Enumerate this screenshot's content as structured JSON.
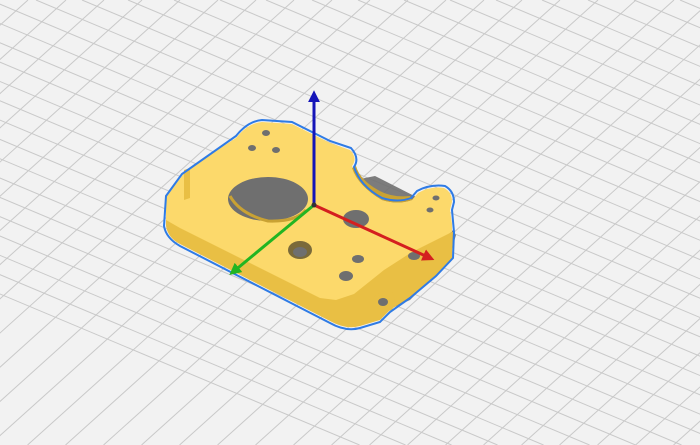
{
  "viewport": {
    "background_color": "#f2f2f2",
    "grid_color": "#c9c9c9",
    "view": "perspective"
  },
  "model": {
    "fill_color": "#fcd96b",
    "shade_color": "#e9bf44",
    "dark_color": "#c9a233",
    "shadow_color": "#6f6f6f",
    "outline_color": "#2f7be5",
    "state": "selected"
  },
  "gizmo": {
    "type": "move",
    "axes": [
      {
        "axis": "x",
        "color": "#d41f1f"
      },
      {
        "axis": "y",
        "color": "#22b522"
      },
      {
        "axis": "z",
        "color": "#1414b8"
      }
    ]
  }
}
